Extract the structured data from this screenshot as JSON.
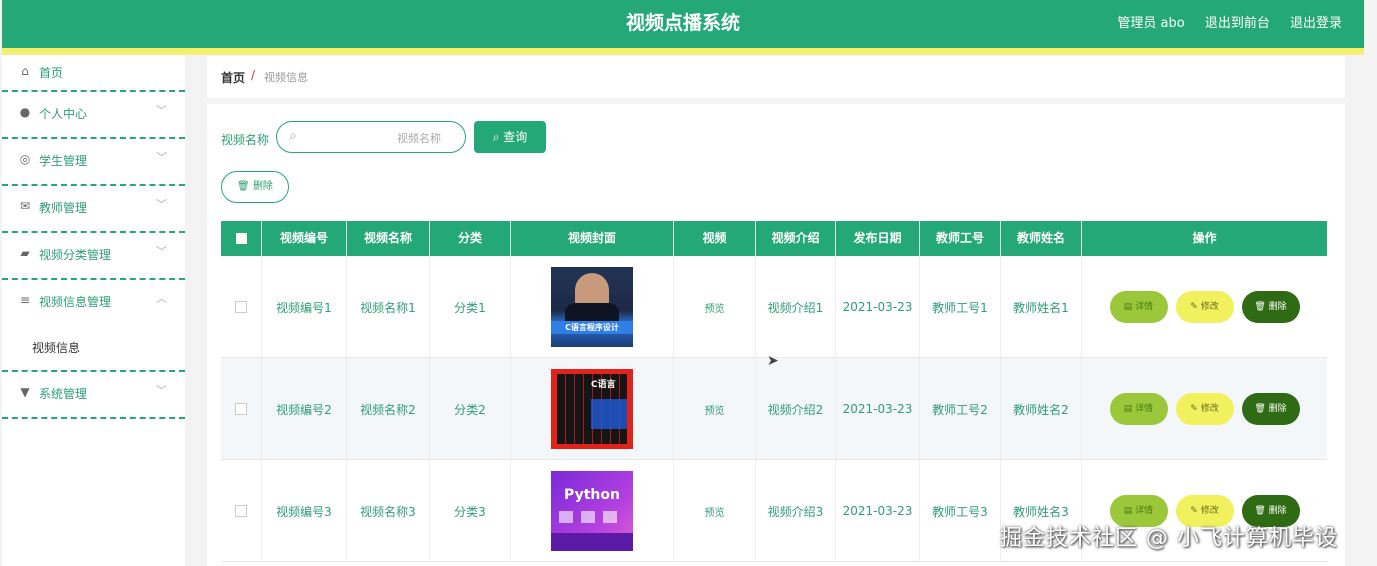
{
  "header": {
    "title": "视频点播系统",
    "admin_label": "管理员 abo",
    "exit_front": "退出到前台",
    "logout": "退出登录"
  },
  "sidebar": {
    "items": [
      {
        "label": "首页",
        "icon": "home-icon"
      },
      {
        "label": "个人中心",
        "icon": "user-icon"
      },
      {
        "label": "学生管理",
        "icon": "globe-icon"
      },
      {
        "label": "教师管理",
        "icon": "mail-icon"
      },
      {
        "label": "视频分类管理",
        "icon": "tag-icon"
      },
      {
        "label": "视频信息管理",
        "icon": "list-icon"
      },
      {
        "label": "系统管理",
        "icon": "settings-icon"
      }
    ],
    "sub_item": "视频信息"
  },
  "breadcrumb": {
    "home": "首页",
    "separator": "/",
    "current": "视频信息"
  },
  "search": {
    "label": "视频名称",
    "placeholder": "视频名称",
    "button": "查询"
  },
  "delete_button": "删除",
  "table": {
    "columns": [
      "视频编号",
      "视频名称",
      "分类",
      "视频封面",
      "视频",
      "视频介绍",
      "发布日期",
      "教师工号",
      "教师姓名",
      "操作"
    ],
    "rows": [
      {
        "code": "视频编号1",
        "name": "视频名称1",
        "category": "分类1",
        "cover": "C语言程序设计",
        "video": "预览",
        "intro": "视频介绍1",
        "date": "2021-03-23",
        "teacher_no": "教师工号1",
        "teacher_name": "教师姓名1"
      },
      {
        "code": "视频编号2",
        "name": "视频名称2",
        "category": "分类2",
        "cover": "C语言",
        "video": "预览",
        "intro": "视频介绍2",
        "date": "2021-03-23",
        "teacher_no": "教师工号2",
        "teacher_name": "教师姓名2"
      },
      {
        "code": "视频编号3",
        "name": "视频名称3",
        "category": "分类3",
        "cover": "Python",
        "video": "预览",
        "intro": "视频介绍3",
        "date": "2021-03-23",
        "teacher_no": "教师工号3",
        "teacher_name": "教师姓名3"
      }
    ],
    "actions": {
      "detail": "详情",
      "edit": "修改",
      "remove": "删除"
    }
  },
  "watermark": "掘金技术社区 @ 小飞计算机毕设",
  "colors": {
    "primary": "#24a878",
    "accent_yellow": "#f4f05a",
    "dark_green": "#2f6a14",
    "lime": "#9bc83a"
  }
}
